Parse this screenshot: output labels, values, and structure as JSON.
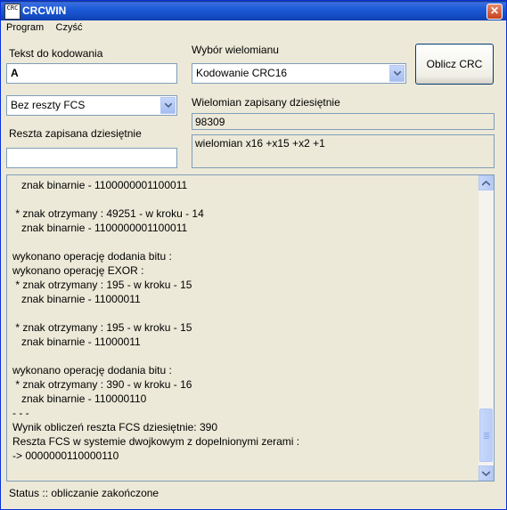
{
  "window": {
    "title": "CRCWIN",
    "app_icon_text": "CRC",
    "close_glyph": "✕"
  },
  "menu": {
    "items": [
      "Program",
      "Czyść"
    ]
  },
  "left": {
    "text_label": "Tekst do kodowania",
    "text_value": "A",
    "fcs_select": "Bez reszty FCS",
    "reszta_label": "Reszta zapisana dziesiętnie",
    "reszta_value": ""
  },
  "middle": {
    "wybor_label": "Wybór wielomianu",
    "wybor_value": "Kodowanie CRC16",
    "dec_label": "Wielomian zapisany dziesiętnie",
    "dec_value": "98309",
    "poly_value": "wielomian x16 +x15 +x2 +1"
  },
  "button": {
    "label": "Oblicz CRC"
  },
  "log": {
    "lines": [
      "   znak binarnie - 1100000001100011",
      "",
      " * znak otrzymany : 49251 - w kroku - 14",
      "   znak binarnie - 1100000001100011",
      "",
      "wykonano operację dodania bitu :",
      "wykonano operację EXOR :",
      " * znak otrzymany : 195 - w kroku - 15",
      "   znak binarnie - 11000011",
      "",
      " * znak otrzymany : 195 - w kroku - 15",
      "   znak binarnie - 11000011",
      "",
      "wykonano operację dodania bitu :",
      " * znak otrzymany : 390 - w kroku - 16",
      "   znak binarnie - 110000110",
      "- - -",
      "Wynik obliczeń reszta FCS dziesiętnie: 390",
      "Reszta FCS w systemie dwojkowym z dopelnionymi zerami :",
      "-> 0000000110000110"
    ]
  },
  "status": {
    "text": "Status :: obliczanie zakończone"
  }
}
